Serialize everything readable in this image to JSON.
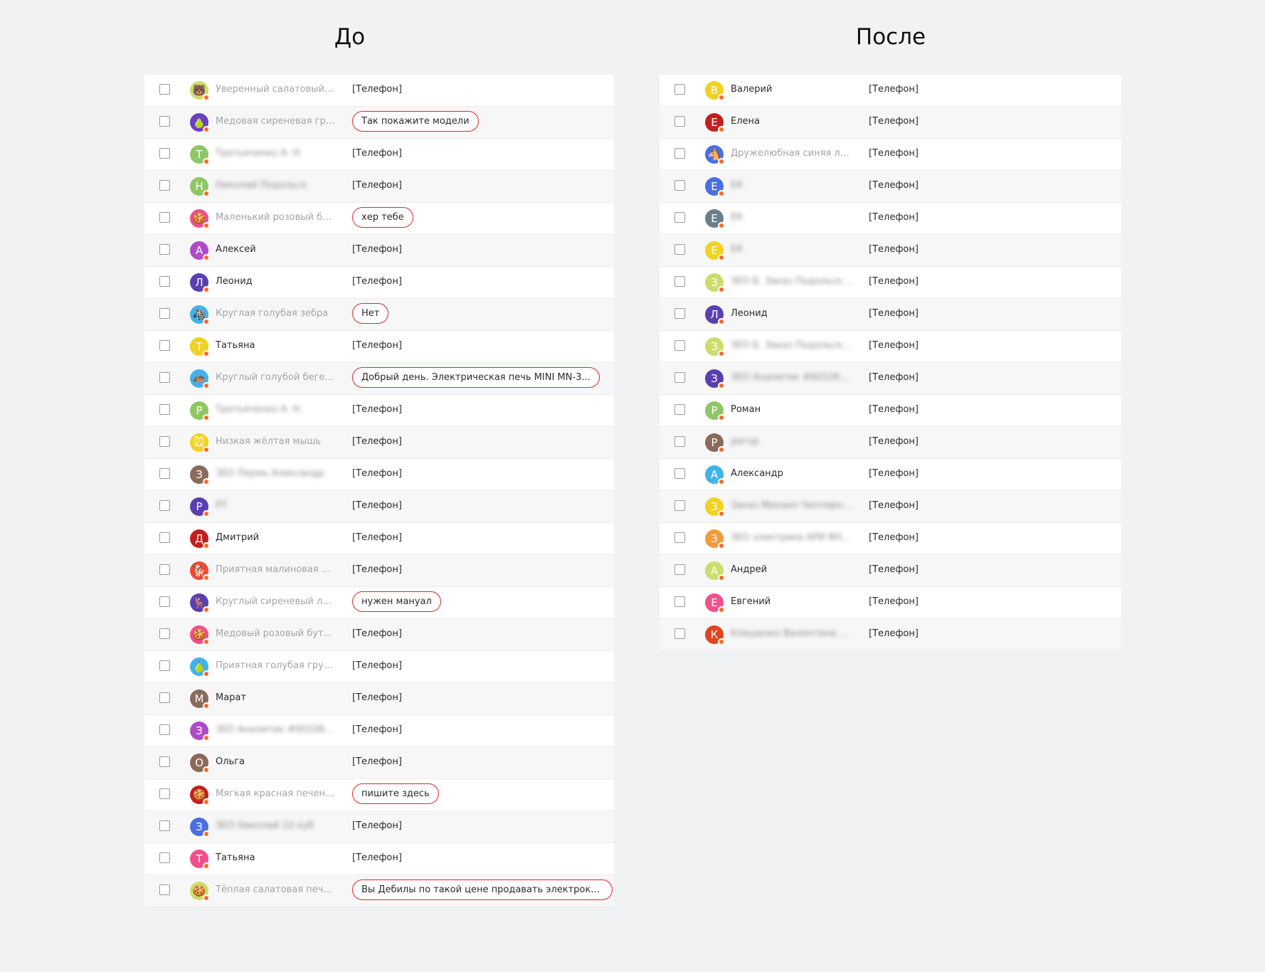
{
  "before": {
    "title": "До",
    "rows": [
      {
        "avatar": "🐻",
        "color": "#cddd6b",
        "name": "Уверенный салатовый м...",
        "style": "anon",
        "msg": "[Телефон]",
        "hl": false
      },
      {
        "avatar": "🍐",
        "color": "#6b3fc4",
        "name": "Медовая сиреневая груша",
        "style": "anon",
        "msg": "Так покажите модели",
        "hl": true
      },
      {
        "avatar": "Т",
        "color": "#8fc766",
        "name": "Третьяченко А. Н.",
        "style": "blur",
        "msg": "[Телефон]",
        "hl": false
      },
      {
        "avatar": "Н",
        "color": "#8fc766",
        "name": "Николай Подольск",
        "style": "blur",
        "msg": "[Телефон]",
        "hl": false
      },
      {
        "avatar": "🍪",
        "color": "#f04f8c",
        "name": "Маленький розовый бут...",
        "style": "anon",
        "msg": "хер тебе",
        "hl": true
      },
      {
        "avatar": "А",
        "color": "#b04bc8",
        "name": "Алексей",
        "style": "",
        "msg": "[Телефон]",
        "hl": false
      },
      {
        "avatar": "Л",
        "color": "#5a3fb0",
        "name": "Леонид",
        "style": "",
        "msg": "[Телефон]",
        "hl": false
      },
      {
        "avatar": "🦓",
        "color": "#41b3ea",
        "name": "Круглая голубая зебра",
        "style": "anon",
        "msg": "Нет",
        "hl": true
      },
      {
        "avatar": "Т",
        "color": "#f2d21f",
        "name": "Татьяна",
        "style": "",
        "msg": "[Телефон]",
        "hl": false
      },
      {
        "avatar": "🦛",
        "color": "#41b3ea",
        "name": "Круглый голубой бегемот",
        "style": "anon",
        "msg": "Добрый день. Электрическая печь MINI MN-3...",
        "hl": true
      },
      {
        "avatar": "Р",
        "color": "#8fc766",
        "name": "Третьяченко А. Н.",
        "style": "blur",
        "msg": "[Телефон]",
        "hl": false
      },
      {
        "avatar": "🐭",
        "color": "#f2d21f",
        "name": "Низкая жёлтая мышь",
        "style": "anon",
        "msg": "[Телефон]",
        "hl": false
      },
      {
        "avatar": "З",
        "color": "#8a6a5a",
        "name": "ЗЕО Пермь Александр",
        "style": "blur",
        "msg": "[Телефон]",
        "hl": false
      },
      {
        "avatar": "Р",
        "color": "#5a3fb0",
        "name": "РТ",
        "style": "blur",
        "msg": "[Телефон]",
        "hl": false
      },
      {
        "avatar": "Д",
        "color": "#c2201f",
        "name": "Дмитрий",
        "style": "",
        "msg": "[Телефон]",
        "hl": false
      },
      {
        "avatar": "🐕",
        "color": "#f0483a",
        "name": "Приятная малиновая соб...",
        "style": "anon",
        "msg": "[Телефон]",
        "hl": false
      },
      {
        "avatar": "🦌",
        "color": "#5a3fb0",
        "name": "Круглый сиреневый лось",
        "style": "anon",
        "msg": "нужен мануал",
        "hl": true
      },
      {
        "avatar": "🍪",
        "color": "#f04f8c",
        "name": "Медовый розовый бутер...",
        "style": "anon",
        "msg": "[Телефон]",
        "hl": false
      },
      {
        "avatar": "🍐",
        "color": "#41b3ea",
        "name": "Приятная голубая груша",
        "style": "anon",
        "msg": "[Телефон]",
        "hl": false
      },
      {
        "avatar": "М",
        "color": "#8a6a5a",
        "name": "Марат",
        "style": "",
        "msg": "[Телефон]",
        "hl": false
      },
      {
        "avatar": "З",
        "color": "#b04bc8",
        "name": "ЗЕО Аналитик #6010878...",
        "style": "blur",
        "msg": "[Телефон]",
        "hl": false
      },
      {
        "avatar": "О",
        "color": "#8a6a5a",
        "name": "Ольга",
        "style": "",
        "msg": "[Телефон]",
        "hl": false
      },
      {
        "avatar": "🍪",
        "color": "#c2201f",
        "name": "Мягкая красная печенька",
        "style": "anon",
        "msg": "пишите здесь",
        "hl": true
      },
      {
        "avatar": "З",
        "color": "#4a6fe0",
        "name": "ЗЕО Николай 10 куб",
        "style": "blur",
        "msg": "[Телефон]",
        "hl": false
      },
      {
        "avatar": "Т",
        "color": "#f04f8c",
        "name": "Татьяна",
        "style": "",
        "msg": "[Телефон]",
        "hl": false
      },
      {
        "avatar": "🍪",
        "color": "#cddd6b",
        "name": "Тёплая салатовая печень...",
        "style": "anon",
        "msg": "Вы Дебилы по такой цене продавать электрокаменк...",
        "hl": true
      }
    ]
  },
  "after": {
    "title": "После",
    "rows": [
      {
        "avatar": "В",
        "color": "#f2d21f",
        "name": "Валерий",
        "style": "",
        "msg": "[Телефон]"
      },
      {
        "avatar": "Е",
        "color": "#c2201f",
        "name": "Елена",
        "style": "",
        "msg": "[Телефон]"
      },
      {
        "avatar": "🐴",
        "color": "#4a6fe0",
        "name": "Дружелюбная синяя лош...",
        "style": "anon",
        "msg": "[Телефон]"
      },
      {
        "avatar": "Е",
        "color": "#4a6fe0",
        "name": "ЕК",
        "style": "blur",
        "msg": "[Телефон]"
      },
      {
        "avatar": "Е",
        "color": "#6a7f8a",
        "name": "ЕК",
        "style": "blur",
        "msg": "[Телефон]"
      },
      {
        "avatar": "Е",
        "color": "#f2d21f",
        "name": "ЕК",
        "style": "blur",
        "msg": "[Телефон]"
      },
      {
        "avatar": "З",
        "color": "#cddd6b",
        "name": "ЗЕО Б. Заказ Подольск Ва...",
        "style": "blur",
        "msg": "[Телефон]"
      },
      {
        "avatar": "Л",
        "color": "#5a3fb0",
        "name": "Леонид",
        "style": "",
        "msg": "[Телефон]"
      },
      {
        "avatar": "З",
        "color": "#cddd6b",
        "name": "ЗЕО Б. Заказ Подольск Ва...",
        "style": "blur",
        "msg": "[Телефон]"
      },
      {
        "avatar": "З",
        "color": "#5a3fb0",
        "name": "ЗЕО Аналитик #6010687...",
        "style": "blur",
        "msg": "[Телефон]"
      },
      {
        "avatar": "Р",
        "color": "#8fc766",
        "name": "Роман",
        "style": "",
        "msg": "[Телефон]"
      },
      {
        "avatar": "Р",
        "color": "#8a6a5a",
        "name": "ригор",
        "style": "blur",
        "msg": "[Телефон]"
      },
      {
        "avatar": "А",
        "color": "#41b3ea",
        "name": "Александр",
        "style": "",
        "msg": "[Телефон]"
      },
      {
        "avatar": "З",
        "color": "#f2d21f",
        "name": "Заказ Михаил Чеплярная...",
        "style": "blur",
        "msg": "[Телефон]"
      },
      {
        "avatar": "З",
        "color": "#f59a3a",
        "name": "ЗЕО электрика АРИ ВНВ ...",
        "style": "blur",
        "msg": "[Телефон]"
      },
      {
        "avatar": "А",
        "color": "#cddd6b",
        "name": "Андрей",
        "style": "",
        "msg": "[Телефон]"
      },
      {
        "avatar": "Е",
        "color": "#f04f8c",
        "name": "Евгений",
        "style": "",
        "msg": "[Телефон]"
      },
      {
        "avatar": "К",
        "color": "#e0451f",
        "name": "Клещенко Валентина Юр...",
        "style": "blur",
        "msg": "[Телефон]"
      }
    ]
  }
}
